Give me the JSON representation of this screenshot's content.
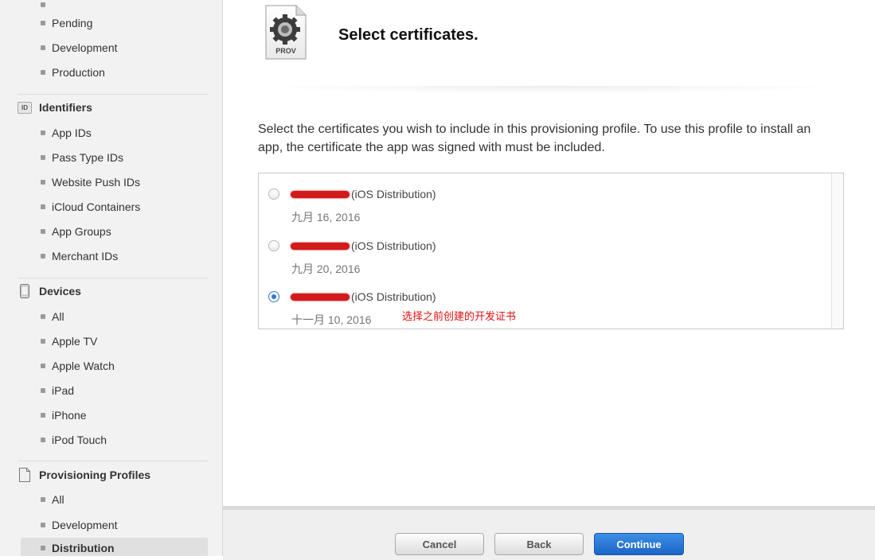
{
  "sidebar": {
    "certificates": {
      "items": [
        {
          "label": "Pending"
        },
        {
          "label": "Development"
        },
        {
          "label": "Production"
        }
      ]
    },
    "identifiers": {
      "title": "Identifiers",
      "icon_text": "ID",
      "items": [
        {
          "label": "App IDs"
        },
        {
          "label": "Pass Type IDs"
        },
        {
          "label": "Website Push IDs"
        },
        {
          "label": "iCloud Containers"
        },
        {
          "label": "App Groups"
        },
        {
          "label": "Merchant IDs"
        }
      ]
    },
    "devices": {
      "title": "Devices",
      "items": [
        {
          "label": "All"
        },
        {
          "label": "Apple TV"
        },
        {
          "label": "Apple Watch"
        },
        {
          "label": "iPad"
        },
        {
          "label": "iPhone"
        },
        {
          "label": "iPod Touch"
        }
      ]
    },
    "provisioning_profiles": {
      "title": "Provisioning Profiles",
      "items": [
        {
          "label": "All"
        },
        {
          "label": "Development"
        },
        {
          "label": "Distribution",
          "active": true
        }
      ]
    }
  },
  "main": {
    "icon_label": "PROV",
    "title": "Select certificates.",
    "instructions": "Select the certificates you wish to include in this provisioning profile. To use this profile to install an app, the certificate the app was signed with must be included.",
    "certificates": [
      {
        "type": "(iOS Distribution)",
        "date": "九月 16, 2016",
        "selected": false
      },
      {
        "type": "(iOS Distribution)",
        "date": "九月 20, 2016",
        "selected": false
      },
      {
        "type": "(iOS Distribution)",
        "date": "十一月 10, 2016",
        "selected": true
      }
    ],
    "annotation": "选择之前创建的开发证书"
  },
  "footer": {
    "cancel_label": "Cancel",
    "back_label": "Back",
    "continue_label": "Continue"
  },
  "colors": {
    "accent": "#2f79d0",
    "redaction": "#d21a1a",
    "annotation": "#e01010"
  }
}
